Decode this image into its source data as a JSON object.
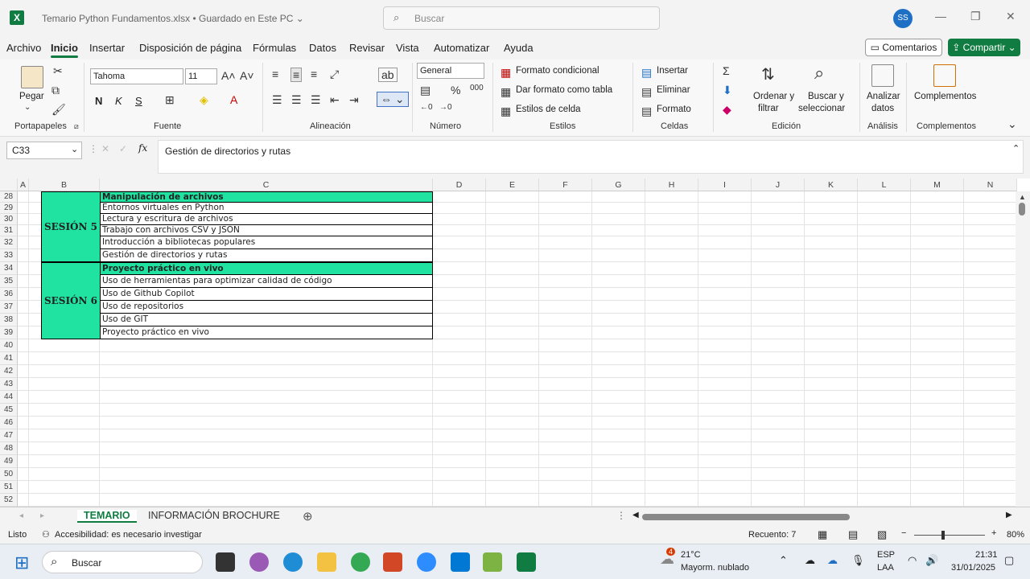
{
  "titlebar": {
    "logo": "X",
    "file": "Temario Python Fundamentos.xlsx",
    "saved": "Guardado en Este PC",
    "search_placeholder": "Buscar",
    "avatar": "SS"
  },
  "menu": {
    "tabs": [
      "Archivo",
      "Inicio",
      "Insertar",
      "Disposición de página",
      "Fórmulas",
      "Datos",
      "Revisar",
      "Vista",
      "Automatizar",
      "Ayuda"
    ],
    "comments": "Comentarios",
    "share": "Compartir"
  },
  "ribbon": {
    "paste": "Pegar",
    "font_name": "Tahoma",
    "font_size": "11",
    "bold": "N",
    "italic": "K",
    "underline": "S",
    "number_format": "General",
    "cond_format": "Formato condicional",
    "table_format": "Dar formato como tabla",
    "cell_styles": "Estilos de celda",
    "insert": "Insertar",
    "delete": "Eliminar",
    "format": "Formato",
    "sort_1": "Ordenar y",
    "sort_2": "filtrar",
    "find_1": "Buscar y",
    "find_2": "seleccionar",
    "analyze_1": "Analizar",
    "analyze_2": "datos",
    "addins": "Complementos",
    "groups": {
      "clipboard": "Portapapeles",
      "font": "Fuente",
      "alignment": "Alineación",
      "number": "Número",
      "styles": "Estilos",
      "cells": "Celdas",
      "editing": "Edición",
      "analysis": "Análisis",
      "addins": "Complementos"
    }
  },
  "formula_bar": {
    "name_box": "C33",
    "fx": "fx",
    "content": "Gestión de directorios y rutas"
  },
  "columns": [
    "A",
    "B",
    "C",
    "D",
    "E",
    "F",
    "G",
    "H",
    "I",
    "J",
    "K",
    "L",
    "M",
    "N"
  ],
  "rows": [
    "28",
    "29",
    "30",
    "31",
    "32",
    "33",
    "34",
    "35",
    "36",
    "37",
    "38",
    "39",
    "40",
    "41",
    "42",
    "43",
    "44",
    "45",
    "46",
    "47",
    "48",
    "49",
    "50",
    "51",
    "52"
  ],
  "sessions": [
    {
      "label": "SESIÓN 5",
      "title": "Manipulación de archivos",
      "items": [
        "Entornos virtuales en Python",
        "Lectura y escritura de archivos",
        "Trabajo con archivos CSV y JSON",
        "Introducción a bibliotecas populares",
        "Gestión de directorios y rutas"
      ]
    },
    {
      "label": "SESIÓN 6",
      "title": "Proyecto práctico en vivo",
      "items": [
        "Uso de herramientas para optimizar calidad de código",
        "Uso de Github Copilot",
        "Uso de repositorios",
        "Uso de GIT",
        "Proyecto práctico en vivo"
      ]
    }
  ],
  "sheets": [
    "TEMARIO",
    "INFORMACIÓN BROCHURE"
  ],
  "status": {
    "ready": "Listo",
    "accessibility": "Accesibilidad: es necesario investigar",
    "count": "Recuento: 7",
    "zoom": "80%"
  },
  "taskbar": {
    "search": "Buscar",
    "weather_badge": "4",
    "temp": "21°C",
    "weather": "Mayorm. nublado",
    "lang1": "ESP",
    "lang2": "LAA",
    "time": "21:31",
    "date": "31/01/2025"
  }
}
